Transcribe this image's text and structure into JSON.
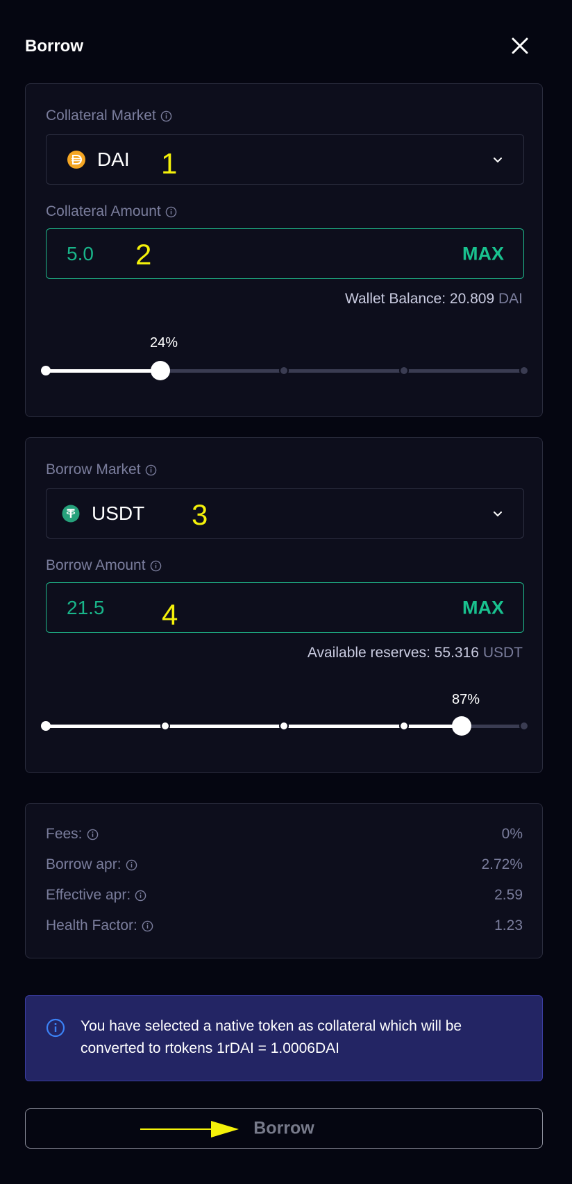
{
  "header": {
    "title": "Borrow"
  },
  "collateral": {
    "market_label": "Collateral Market",
    "token": "DAI",
    "amount_label": "Collateral Amount",
    "amount_value": "5.0",
    "max_label": "MAX",
    "balance_label": "Wallet Balance: 20.809",
    "balance_unit": "DAI",
    "slider_percent": "24%",
    "slider_level": 0.24
  },
  "borrow": {
    "market_label": "Borrow Market",
    "token": "USDT",
    "amount_label": "Borrow Amount",
    "amount_value": "21.5",
    "max_label": "MAX",
    "reserves_label": "Available reserves: 55.316",
    "reserves_unit": "USDT",
    "slider_percent": "87%",
    "slider_level": 0.87
  },
  "stats": [
    {
      "label": "Fees:",
      "value": "0%"
    },
    {
      "label": "Borrow apr:",
      "value": "2.72%"
    },
    {
      "label": "Effective apr:",
      "value": "2.59"
    },
    {
      "label": "Health Factor:",
      "value": "1.23"
    }
  ],
  "notice": {
    "text": "You have selected a native token as collateral which will be converted to rtokens 1rDAI = 1.0006DAI"
  },
  "action": {
    "borrow_label": "Borrow"
  },
  "annotations": [
    "1",
    "2",
    "3",
    "4"
  ],
  "colors": {
    "background": "#050611",
    "card": "#0d0e1c",
    "accent": "#19b58a",
    "notice": "#232564",
    "annotation": "#f4f10a"
  }
}
